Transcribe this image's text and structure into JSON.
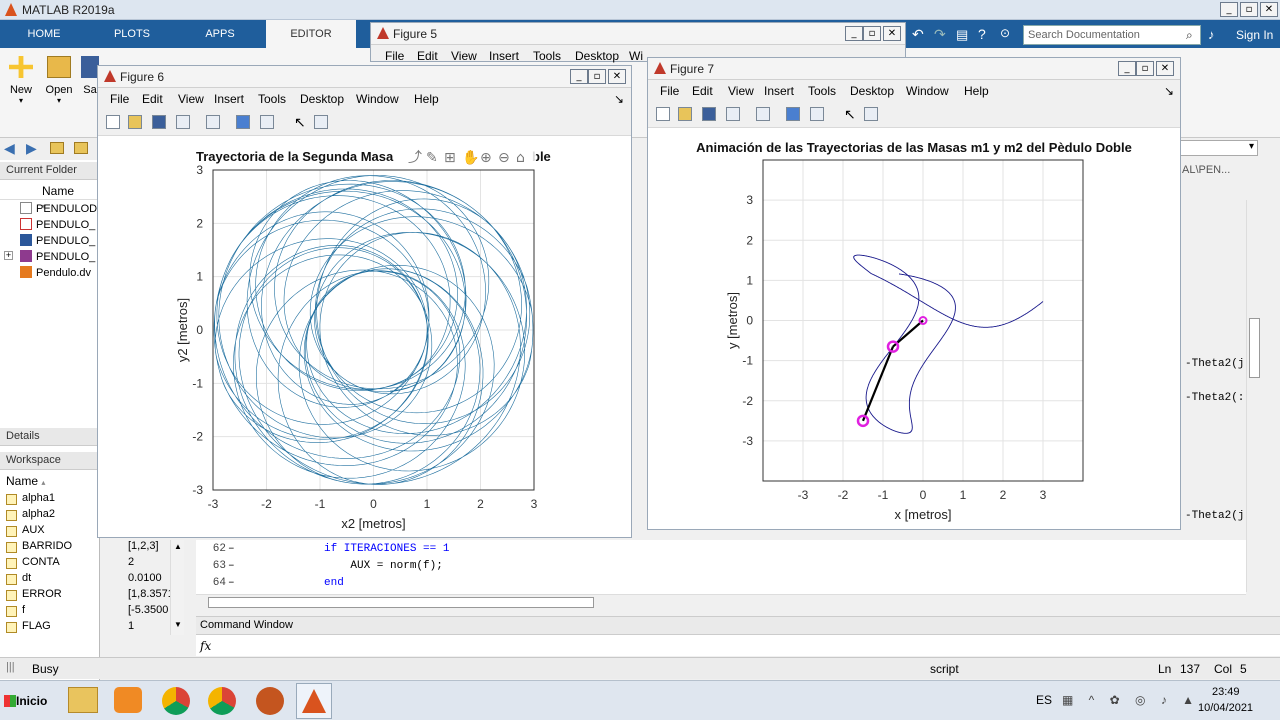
{
  "app": {
    "title": "MATLAB R2019a",
    "search_placeholder": "Search Documentation",
    "signin": "Sign In"
  },
  "ribbon": {
    "tabs": [
      "HOME",
      "PLOTS",
      "APPS",
      "EDITOR"
    ],
    "active_tab": "EDITOR",
    "buttons": [
      "New",
      "Open",
      "Sa"
    ]
  },
  "panels": {
    "current_folder": "Current Folder",
    "name_col": "Name",
    "files": [
      "PENDULOD",
      "PENDULO_",
      "PENDULO_",
      "PENDULO_",
      "Pendulo.dv"
    ],
    "details": "Details",
    "workspace": "Workspace",
    "ws_name_col": "Name",
    "variables": [
      {
        "name": "alpha1",
        "value": ""
      },
      {
        "name": "alpha2",
        "value": ""
      },
      {
        "name": "AUX",
        "value": ""
      },
      {
        "name": "BARRIDO",
        "value": "[1,2,3]"
      },
      {
        "name": "CONTA",
        "value": "2"
      },
      {
        "name": "dt",
        "value": "0.0100"
      },
      {
        "name": "ERROR",
        "value": "[1,8.3571"
      },
      {
        "name": "f",
        "value": "[-5.3500"
      },
      {
        "name": "FLAG",
        "value": "1"
      }
    ]
  },
  "editor": {
    "lines": [
      {
        "num": "62",
        "code": "if ITERACIONES == 1"
      },
      {
        "num": "63",
        "code": "    AUX = norm(f);"
      },
      {
        "num": "64",
        "code": "end"
      }
    ],
    "side_text": [
      "-Theta2(j",
      "-Theta2(:",
      "-Theta2(j"
    ],
    "path_fragment": "AL\\PEN..."
  },
  "command_window": {
    "title": "Command Window",
    "prompt": "fx"
  },
  "status": {
    "state": "Busy",
    "mode": "script",
    "ln_label": "Ln",
    "ln": "137",
    "col_label": "Col",
    "col": "5"
  },
  "taskbar": {
    "start": "Inicio",
    "lang": "ES",
    "time": "23:49",
    "date": "10/04/2021"
  },
  "figure5": {
    "title": "Figure 5",
    "menus": [
      "File",
      "Edit",
      "View",
      "Insert",
      "Tools",
      "Desktop",
      "Wi"
    ]
  },
  "figure6": {
    "title": "Figure 6",
    "menus": [
      "File",
      "Edit",
      "View",
      "Insert",
      "Tools",
      "Desktop",
      "Window",
      "Help"
    ],
    "chart_data": {
      "type": "line",
      "title": "Trayectoria de la Segunda Masa",
      "title_tail": "ble",
      "xlabel": "x2 [metros]",
      "ylabel": "y2 [metros]",
      "xlim": [
        -3,
        3
      ],
      "ylim": [
        -3,
        3
      ],
      "xticks": [
        "-3",
        "-2",
        "-1",
        "0",
        "1",
        "2",
        "3"
      ],
      "yticks": [
        "3",
        "2",
        "1",
        "0",
        "-1",
        "-2",
        "-3"
      ],
      "grid": true,
      "series_color": "#1f6f9f"
    }
  },
  "figure7": {
    "title": "Figure 7",
    "menus": [
      "File",
      "Edit",
      "View",
      "Insert",
      "Tools",
      "Desktop",
      "Window",
      "Help"
    ],
    "chart_data": {
      "type": "line",
      "title": "Animación de las Trayectorias de las Masas m1 y m2 del Pèdulo Doble",
      "xlabel": "x [metros]",
      "ylabel": "y [metros]",
      "xlim": [
        -4,
        4
      ],
      "ylim": [
        -4,
        4
      ],
      "xticks": [
        "-3",
        "-2",
        "-1",
        "0",
        "1",
        "2",
        "3"
      ],
      "yticks": [
        "3",
        "2",
        "1",
        "0",
        "-1",
        "-2",
        "-3"
      ],
      "grid": true,
      "pivot": {
        "x": 0,
        "y": 0
      },
      "mass1": {
        "x": -0.75,
        "y": -0.65
      },
      "mass2": {
        "x": -1.5,
        "y": -2.5
      },
      "series_color": "#1a1a8c",
      "mass_color": "#e020e0"
    }
  }
}
